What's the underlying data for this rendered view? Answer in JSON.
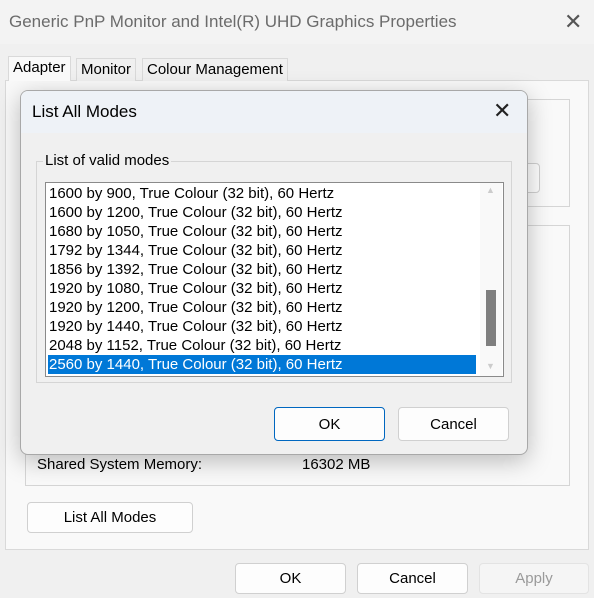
{
  "window": {
    "title": "Generic PnP Monitor and Intel(R) UHD Graphics Properties"
  },
  "tabs": [
    {
      "label": "Adapter",
      "active": true
    },
    {
      "label": "Monitor"
    },
    {
      "label": "Colour Management"
    }
  ],
  "adapter": {
    "shared_memory_label": "Shared System Memory:",
    "shared_memory_value": "16302 MB",
    "list_all_modes_label": "List All Modes"
  },
  "footer": {
    "ok": "OK",
    "cancel": "Cancel",
    "apply": "Apply",
    "apply_disabled": true
  },
  "dialog": {
    "title": "List All Modes",
    "group_label": "List of valid modes",
    "modes": [
      "1600 by 900, True Colour (32 bit), 60 Hertz",
      "1600 by 1200, True Colour (32 bit), 60 Hertz",
      "1680 by 1050, True Colour (32 bit), 60 Hertz",
      "1792 by 1344, True Colour (32 bit), 60 Hertz",
      "1856 by 1392, True Colour (32 bit), 60 Hertz",
      "1920 by 1080, True Colour (32 bit), 60 Hertz",
      "1920 by 1200, True Colour (32 bit), 60 Hertz",
      "1920 by 1440, True Colour (32 bit), 60 Hertz",
      "2048 by 1152, True Colour (32 bit), 60 Hertz",
      "2560 by 1440, True Colour (32 bit), 60 Hertz"
    ],
    "selected_index": 9,
    "ok": "OK",
    "cancel": "Cancel"
  },
  "colors": {
    "selection": "#0078d7"
  },
  "icons": {
    "close": "close-icon",
    "scroll_up": "chevron-up-icon",
    "scroll_down": "chevron-down-icon"
  }
}
